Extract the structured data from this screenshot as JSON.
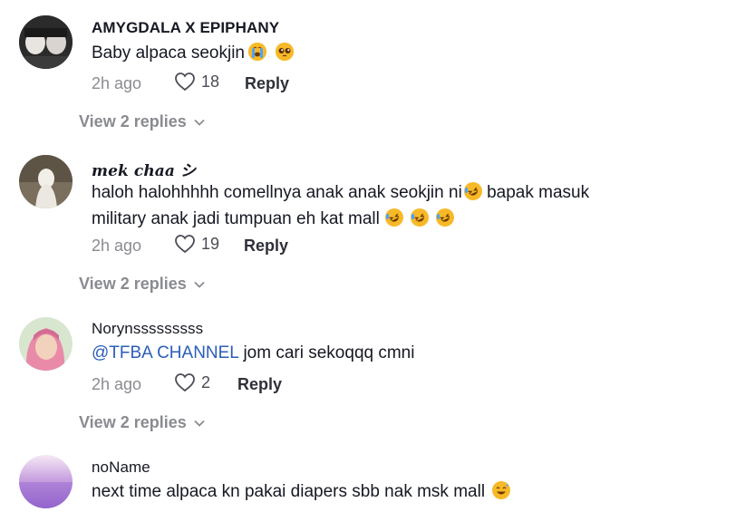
{
  "comments": [
    {
      "username": "AMYGDALA X EPIPHANY",
      "text": "Baby alpaca seokjin",
      "emoji_icons": [
        "loudly-crying-face-icon",
        "pleading-face-icon"
      ],
      "time": "2h ago",
      "likes": "18",
      "reply_label": "Reply",
      "view_replies": "View 2 replies"
    },
    {
      "username": "mek chaa シ",
      "text_line1": "haloh halohhhhh comellnya anak anak seokjin ni",
      "text_line1_after": " bapak masuk",
      "text_line2": "military anak jadi tumpuan eh kat mall",
      "emoji_icons": [
        "rolling-on-floor-laughing-icon"
      ],
      "time": "2h ago",
      "likes": "19",
      "reply_label": "Reply",
      "view_replies": "View 2 replies"
    },
    {
      "username": "Norynsssssssss",
      "mention": "@TFBA CHANNEL",
      "text": " jom cari sekoqqq cmni",
      "time": "2h ago",
      "likes": "2",
      "reply_label": "Reply",
      "view_replies": "View 2 replies"
    },
    {
      "username": "noName",
      "text": "next time alpaca kn pakai diapers sbb nak msk mall",
      "emoji_icons": [
        "smiling-face-with-sweat-icon"
      ]
    }
  ],
  "colors": {
    "username": "#161823",
    "meta_gray": "#8a8b91",
    "mention": "#2b5db9",
    "emoji_yellow": "#f7b928"
  }
}
